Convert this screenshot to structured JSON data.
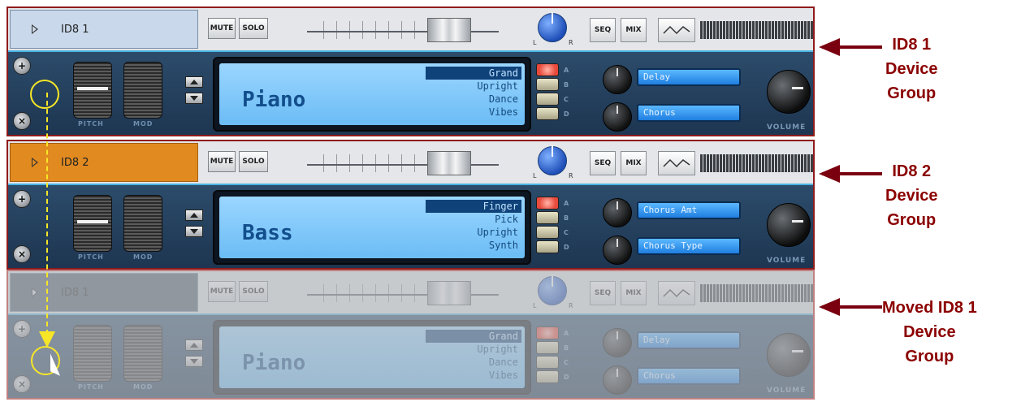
{
  "racks": [
    {
      "name": "ID8 1",
      "mute": "MUTE",
      "solo": "SOLO",
      "pan_l": "L",
      "pan_r": "R",
      "seq": "SEQ",
      "mix": "MIX",
      "patch": "Piano",
      "patch_items": [
        "Grand",
        "Upright",
        "Dance",
        "Vibes"
      ],
      "selected_patch_index": 0,
      "abcd": [
        "A",
        "B",
        "C",
        "D"
      ],
      "fx1": "Delay",
      "fx2": "Chorus",
      "pitch_label": "PITCH",
      "mod_label": "MOD",
      "volume_label": "VOLUME",
      "name_color": "#c9d8ea"
    },
    {
      "name": "ID8 2",
      "mute": "MUTE",
      "solo": "SOLO",
      "pan_l": "L",
      "pan_r": "R",
      "seq": "SEQ",
      "mix": "MIX",
      "patch": "Bass",
      "patch_items": [
        "Finger",
        "Pick",
        "Upright",
        "Synth"
      ],
      "selected_patch_index": 0,
      "abcd": [
        "A",
        "B",
        "C",
        "D"
      ],
      "fx1": "Chorus Amt",
      "fx2": "Chorus Type",
      "pitch_label": "PITCH",
      "mod_label": "MOD",
      "volume_label": "VOLUME",
      "name_color": "#e08a20"
    },
    {
      "name": "ID8 1",
      "mute": "MUTE",
      "solo": "SOLO",
      "pan_l": "L",
      "pan_r": "R",
      "seq": "SEQ",
      "mix": "MIX",
      "patch": "Piano",
      "patch_items": [
        "Grand",
        "Upright",
        "Dance",
        "Vibes"
      ],
      "selected_patch_index": 0,
      "abcd": [
        "A",
        "B",
        "C",
        "D"
      ],
      "fx1": "Delay",
      "fx2": "Chorus",
      "pitch_label": "PITCH",
      "mod_label": "MOD",
      "volume_label": "VOLUME",
      "name_color": "#3b4856"
    }
  ],
  "callouts": [
    {
      "lines": [
        "ID8 1",
        "Device",
        "Group"
      ]
    },
    {
      "lines": [
        "ID8 2",
        "Device",
        "Group"
      ]
    },
    {
      "lines": [
        "Moved ID8 1",
        "Device",
        "Group"
      ]
    }
  ],
  "colors": {
    "callout": "#8b0000",
    "drag_indicator": "#f7e627"
  },
  "icons": {
    "disclosure": "disclosure-triangle-icon",
    "up": "arrow-up-icon",
    "down": "arrow-down-icon",
    "plus_screw": "plus-screw-icon",
    "x_screw": "x-screw-icon",
    "callout_arrow": "left-arrow-icon",
    "cursor": "mouse-pointer-icon"
  }
}
